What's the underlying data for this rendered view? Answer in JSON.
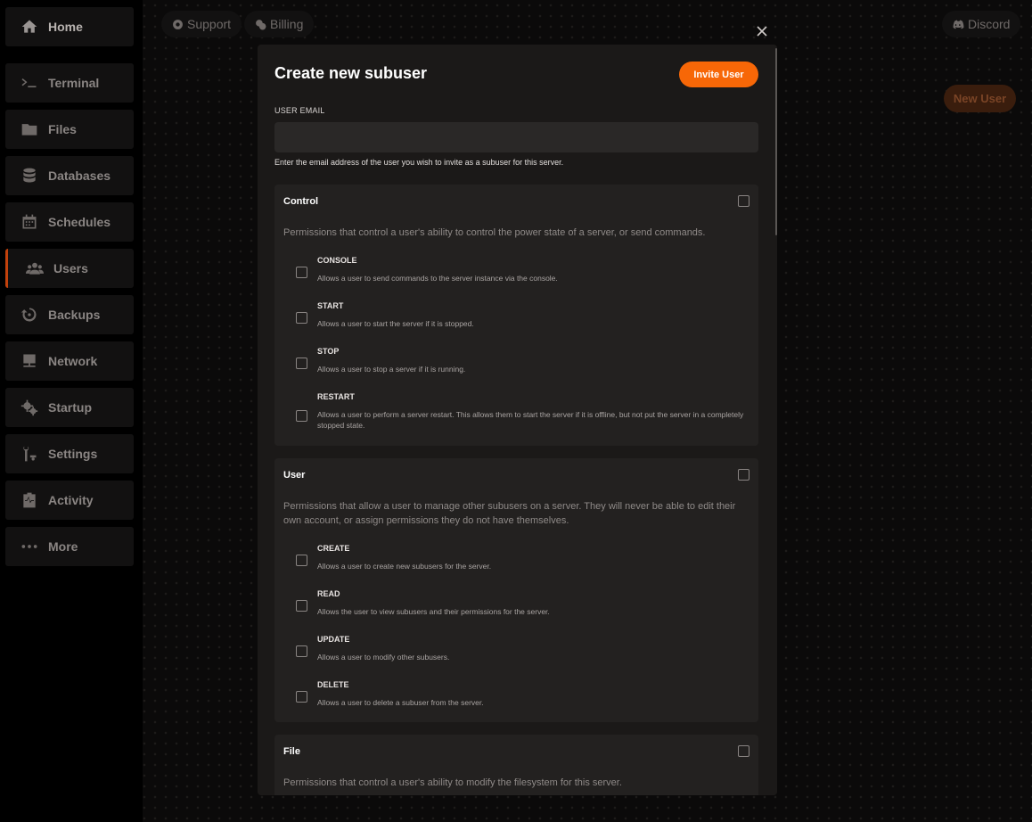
{
  "sidebar": {
    "items": [
      {
        "label": "Home",
        "icon": "home-icon"
      },
      {
        "label": "Terminal",
        "icon": "terminal-icon"
      },
      {
        "label": "Files",
        "icon": "folder-icon"
      },
      {
        "label": "Databases",
        "icon": "database-icon"
      },
      {
        "label": "Schedules",
        "icon": "calendar-icon"
      },
      {
        "label": "Users",
        "icon": "users-icon"
      },
      {
        "label": "Backups",
        "icon": "backup-icon"
      },
      {
        "label": "Network",
        "icon": "network-icon"
      },
      {
        "label": "Startup",
        "icon": "gears-icon"
      },
      {
        "label": "Settings",
        "icon": "wrench-icon"
      },
      {
        "label": "Activity",
        "icon": "clipboard-icon"
      },
      {
        "label": "More",
        "icon": "more-icon"
      }
    ]
  },
  "topbar": {
    "support": "Support",
    "billing": "Billing",
    "discord": "Discord"
  },
  "page": {
    "new_user": "New User"
  },
  "modal": {
    "title": "Create new subuser",
    "invite_button": "Invite User",
    "email_label": "USER EMAIL",
    "email_value": "",
    "email_help": "Enter the email address of the user you wish to invite as a subuser for this server.",
    "groups": [
      {
        "title": "Control",
        "description": "Permissions that control a user's ability to control the power state of a server, or send commands.",
        "permissions": [
          {
            "name": "CONSOLE",
            "description": "Allows a user to send commands to the server instance via the console."
          },
          {
            "name": "START",
            "description": "Allows a user to start the server if it is stopped."
          },
          {
            "name": "STOP",
            "description": "Allows a user to stop a server if it is running."
          },
          {
            "name": "RESTART",
            "description": "Allows a user to perform a server restart. This allows them to start the server if it is offline, but not put the server in a completely stopped state."
          }
        ]
      },
      {
        "title": "User",
        "description": "Permissions that allow a user to manage other subusers on a server. They will never be able to edit their own account, or assign permissions they do not have themselves.",
        "permissions": [
          {
            "name": "CREATE",
            "description": "Allows a user to create new subusers for the server."
          },
          {
            "name": "READ",
            "description": "Allows the user to view subusers and their permissions for the server."
          },
          {
            "name": "UPDATE",
            "description": "Allows a user to modify other subusers."
          },
          {
            "name": "DELETE",
            "description": "Allows a user to delete a subuser from the server."
          }
        ]
      },
      {
        "title": "File",
        "description": "Permissions that control a user's ability to modify the filesystem for this server.",
        "permissions": []
      }
    ]
  },
  "colors": {
    "accent": "#f76707",
    "active_border": "#c2410c",
    "modal_bg": "#1b1918",
    "group_bg": "#232120"
  }
}
